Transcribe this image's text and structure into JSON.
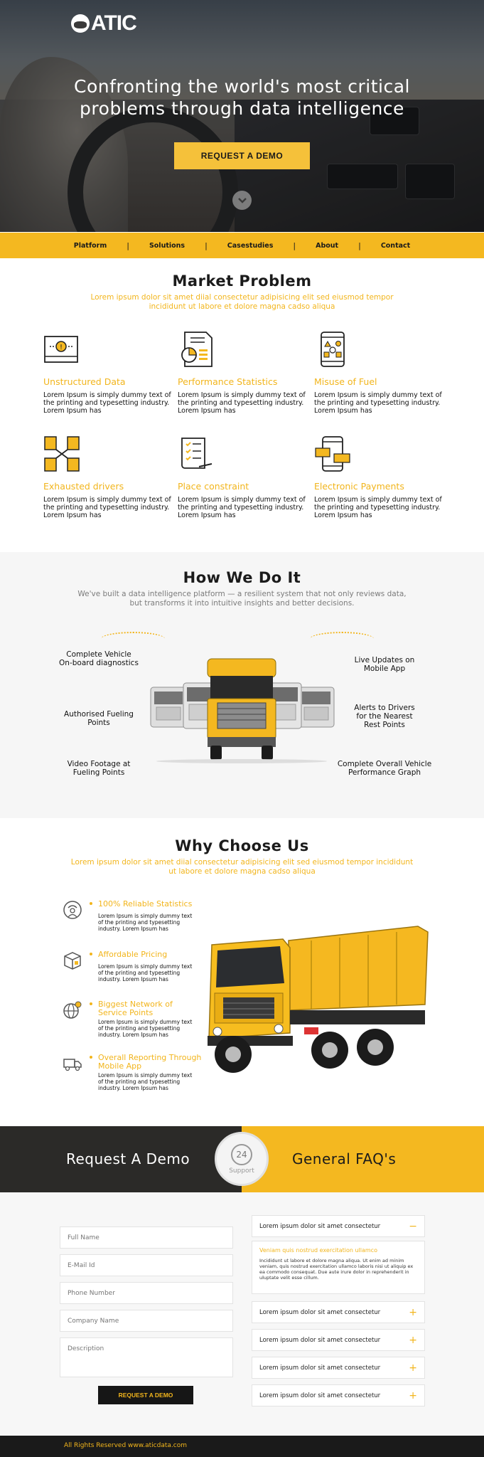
{
  "hero": {
    "logo": "ATIC",
    "headline_1": "Confronting the world's most critical",
    "headline_2": "problems through data intelligence",
    "cta_label": "REQUEST A DEMO"
  },
  "nav": {
    "items": [
      "Platform",
      "Solutions",
      "Casestudies",
      "About",
      "Contact"
    ]
  },
  "market_problem": {
    "title": "Market Problem",
    "subtitle_1": "Lorem ipsum dolor sit amet diial consectetur adipisicing elit sed eiusmod tempor",
    "subtitle_2": "incididunt ut labore et dolore magna cadso aliqua",
    "items": [
      {
        "title": "Unstructured Data",
        "icon": "document-alert-icon",
        "text": "Lorem Ipsum is simply dummy text of the printing and typesetting industry. Lorem Ipsum has"
      },
      {
        "title": "Performance Statistics",
        "icon": "report-chart-icon",
        "text": "Lorem Ipsum is simply dummy text of the printing and typesetting industry. Lorem Ipsum has"
      },
      {
        "title": "Misuse of Fuel",
        "icon": "mobile-shapes-icon",
        "text": "Lorem Ipsum is simply dummy text of the printing and typesetting industry. Lorem Ipsum has"
      },
      {
        "title": "Exhausted drivers",
        "icon": "documents-cross-icon",
        "text": "Lorem Ipsum is simply dummy text of the printing and typesetting industry. Lorem Ipsum has"
      },
      {
        "title": "Place constraint",
        "icon": "checklist-scroll-icon",
        "text": "Lorem Ipsum is simply dummy text of the printing and typesetting industry. Lorem Ipsum has"
      },
      {
        "title": "Electronic Payments",
        "icon": "mobile-chat-icon",
        "text": "Lorem Ipsum is simply dummy text of the printing and typesetting industry. Lorem Ipsum has"
      }
    ]
  },
  "how": {
    "title": "How We Do It",
    "subtitle_1": "We've built a data intelligence platform — a resilient system that not only reviews data,",
    "subtitle_2": "but transforms it into intuitive insights and better decisions.",
    "left": [
      {
        "l1": "Complete Vehicle",
        "l2": "On-board diagnostics"
      },
      {
        "l1": "Authorised Fueling",
        "l2": "Points"
      },
      {
        "l1": "Video Footage at",
        "l2": "Fueling Points"
      }
    ],
    "right": [
      {
        "l1": "Live Updates on",
        "l2": "Mobile App",
        "l3": ""
      },
      {
        "l1": "Alerts to Drivers",
        "l2": "for the Nearest",
        "l3": "Rest Points"
      },
      {
        "l1": "Complete Overall Vehicle",
        "l2": "Performance Graph",
        "l3": ""
      }
    ]
  },
  "why": {
    "title": "Why Choose Us",
    "subtitle_1": "Lorem ipsum dolor sit amet diial consectetur adipisicing elit sed eiusmod tempor incididunt",
    "subtitle_2": "ut labore et dolore magna cadso aliqua",
    "items": [
      {
        "t1": "100% Reliable Statistics",
        "t2": "",
        "icon": "shield-person-icon",
        "p1": "Lorem Ipsum is simply dummy text",
        "p2": "of the printing and typesetting",
        "p3": "industry. Lorem Ipsum has"
      },
      {
        "t1": "Affordable Pricing",
        "t2": "",
        "icon": "box-icon",
        "p1": "Lorem Ipsum is simply dummy text",
        "p2": "of the printing and typesetting",
        "p3": "industry. Lorem Ipsum has"
      },
      {
        "t1": "Biggest Network of",
        "t2": "Service Points",
        "icon": "globe-pin-icon",
        "p1": "Lorem Ipsum is simply dummy text",
        "p2": "of the printing and typesetting",
        "p3": "industry. Lorem Ipsum has"
      },
      {
        "t1": "Overall Reporting Through",
        "t2": "Mobile App",
        "icon": "truck-icon",
        "p1": "Lorem Ipsum is simply dummy text",
        "p2": "of the printing and typesetting",
        "p3": "industry. Lorem Ipsum has"
      }
    ]
  },
  "banner": {
    "left": "Request A Demo",
    "right": "General FAQ's",
    "support_hours": "24",
    "support_label": "Support"
  },
  "form": {
    "full_name": "Full Name",
    "email": "E-Mail Id",
    "phone": "Phone Number",
    "company": "Company Name",
    "description": "Description",
    "submit": "REQUEST A DEMO"
  },
  "faq": {
    "q1": "Lorem ipsum dolor sit amet consectetur",
    "open_title": "Veniam quis nostrud exercitation ullamco",
    "open_text": "Incididunt ut labore et dolore magna aliqua. Ut enim ad minim veniam, quis nostrud exercitation ullamco laboris nisi ut aliquip ex ea commodo consequat. Due aute irure dolor in reprehenderit in uluptate velit esse cillum.",
    "q2": "Lorem ipsum dolor sit amet consectetur",
    "q3": "Lorem ipsum dolor sit amet consectetur",
    "q4": "Lorem ipsum dolor sit amet consectetur",
    "q5": "Lorem ipsum dolor sit amet consectetur",
    "minus": "−",
    "plus": "+"
  },
  "footer": {
    "text": "All Rights Reserved www.aticdata.com"
  },
  "colors": {
    "accent": "#f4b820",
    "dark": "#2b2a28"
  }
}
